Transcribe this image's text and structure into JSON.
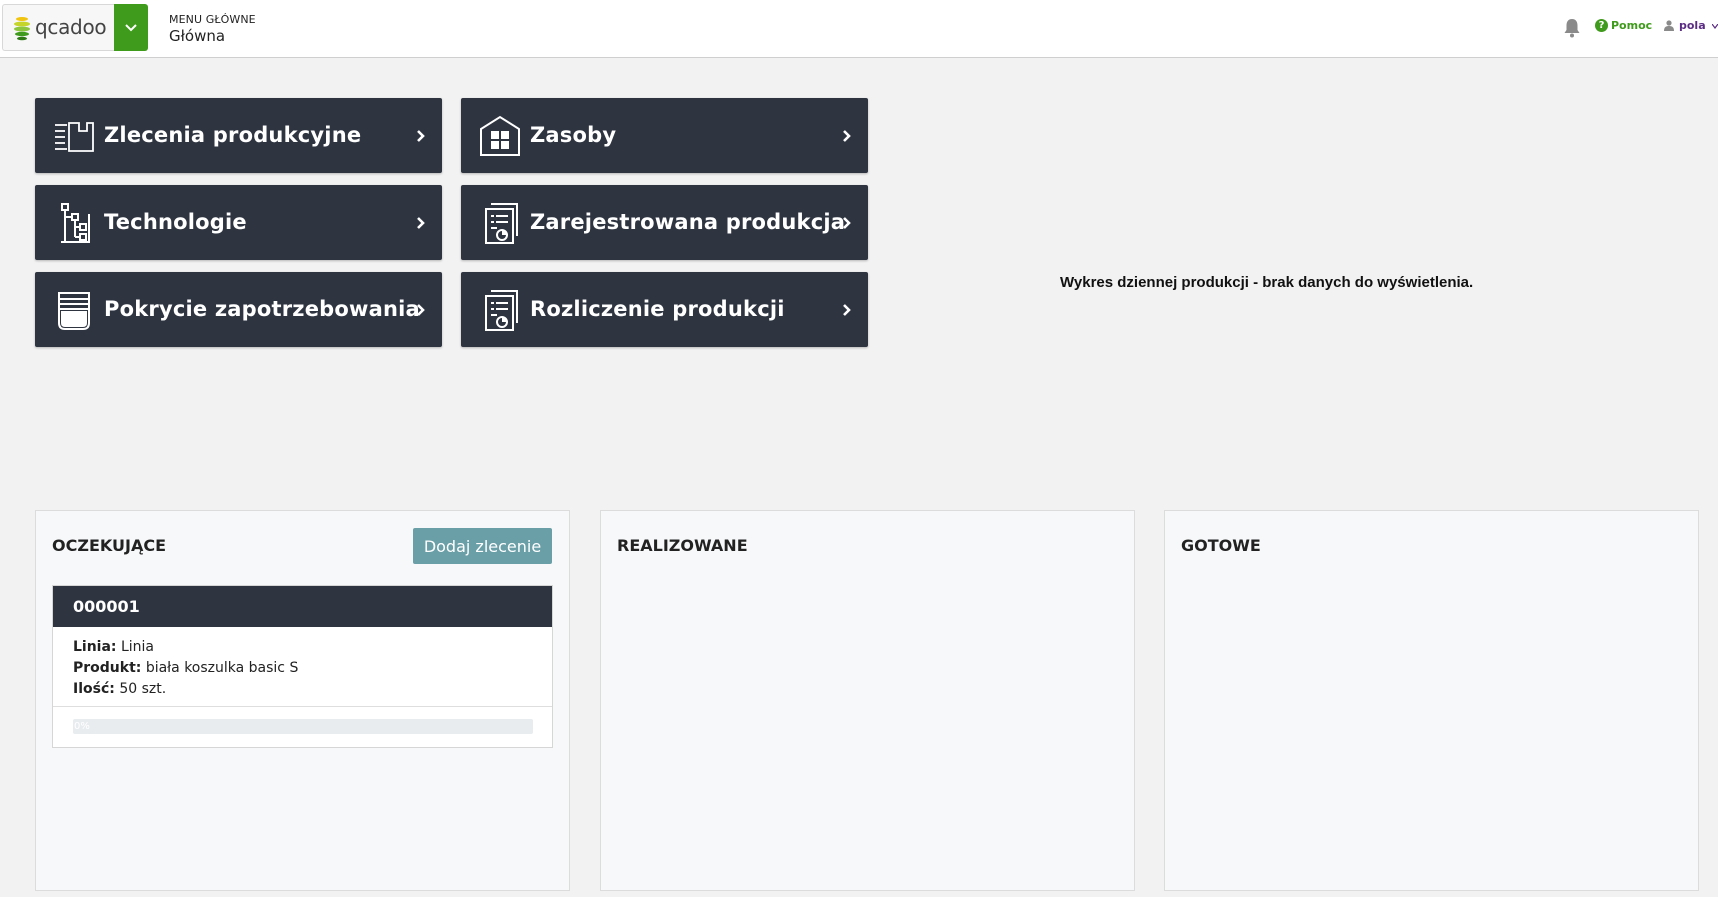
{
  "header": {
    "logo_text": "qcadoo",
    "menu_caption": "MENU GŁÓWNE",
    "menu_current": "Główna",
    "help_label": "Pomoc",
    "user_name": "pola"
  },
  "tiles": [
    {
      "label": "Zlecenia produkcyjne",
      "icon": "production-orders-icon"
    },
    {
      "label": "Zasoby",
      "icon": "warehouse-icon"
    },
    {
      "label": "Technologie",
      "icon": "technology-tree-icon"
    },
    {
      "label": "Zarejestrowana produkcja",
      "icon": "report-document-icon"
    },
    {
      "label": "Pokrycie zapotrzebowania",
      "icon": "container-icon"
    },
    {
      "label": "Rozliczenie produkcji",
      "icon": "report-document-icon"
    }
  ],
  "chart_message": "Wykres dziennej produkcji - brak danych do wyświetlenia.",
  "columns": {
    "pending": {
      "title": "OCZEKUJĄCE",
      "add_button": "Dodaj zlecenie",
      "orders": [
        {
          "number": "000001",
          "line_label": "Linia:",
          "line_value": "Linia",
          "product_label": "Produkt:",
          "product_value": "biała koszulka basic S",
          "qty_label": "Ilość:",
          "qty_value": "50 szt.",
          "progress_text": "0%",
          "progress_value": 0
        }
      ]
    },
    "in_progress": {
      "title": "REALIZOWANE"
    },
    "done": {
      "title": "GOTOWE"
    }
  },
  "colors": {
    "accent_green": "#3f9b1b",
    "tile_bg": "#2e3440",
    "button_teal": "#6a9fa8",
    "user_purple": "#5b2c83"
  }
}
